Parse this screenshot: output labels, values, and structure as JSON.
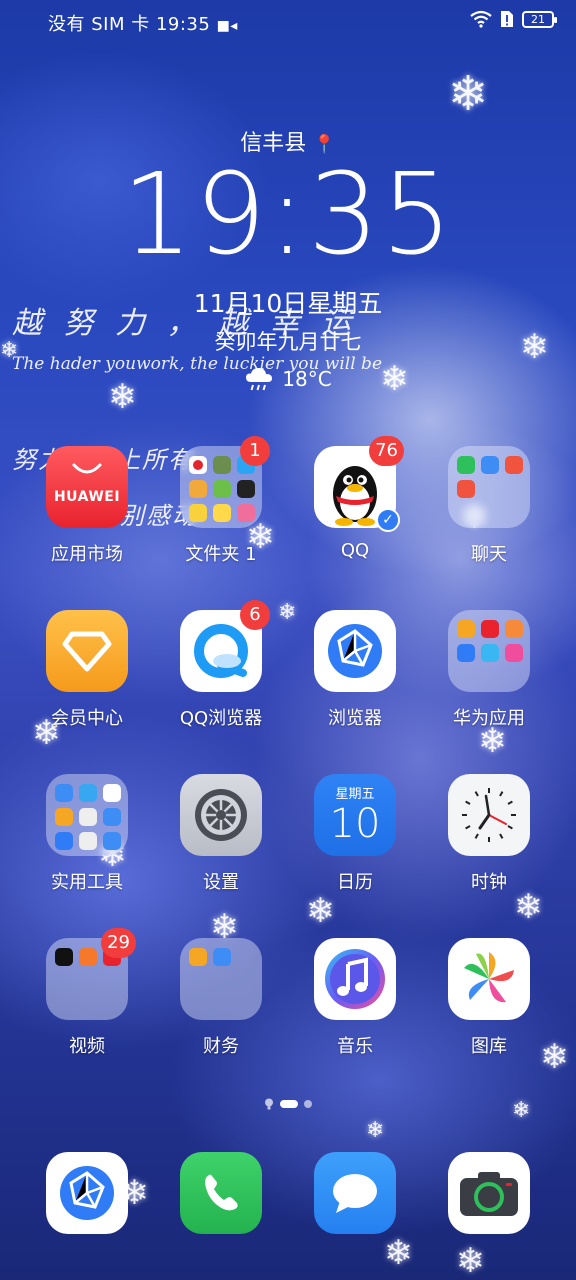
{
  "status_bar": {
    "carrier": "没有 SIM 卡",
    "time": "19:35",
    "battery": "21"
  },
  "widget": {
    "location": "信丰县",
    "time": "19:35",
    "date": "11月10日星期五",
    "lunar": "癸卯年九月廿七",
    "temperature": "18°C"
  },
  "decor": {
    "line1": "越 努 力 ， 越 幸 运",
    "line2": "The hader youwork, the luckier you will be",
    "line3": "努力配得上所有",
    "line4": "别感动"
  },
  "apps": [
    {
      "label": "应用市场",
      "badge": "",
      "tile_text": "HUAWEI"
    },
    {
      "label": "文件夹 1",
      "badge": "1"
    },
    {
      "label": "QQ",
      "badge": "76"
    },
    {
      "label": "聊天",
      "badge": ""
    },
    {
      "label": "会员中心",
      "badge": ""
    },
    {
      "label": "QQ浏览器",
      "badge": "6"
    },
    {
      "label": "浏览器",
      "badge": ""
    },
    {
      "label": "华为应用",
      "badge": ""
    },
    {
      "label": "实用工具",
      "badge": ""
    },
    {
      "label": "设置",
      "badge": ""
    },
    {
      "label": "日历",
      "badge": "",
      "weekday": "星期五",
      "day": "10"
    },
    {
      "label": "时钟",
      "badge": ""
    },
    {
      "label": "视频",
      "badge": "29"
    },
    {
      "label": "财务",
      "badge": ""
    },
    {
      "label": "音乐",
      "badge": ""
    },
    {
      "label": "图库",
      "badge": ""
    }
  ],
  "dock": [
    "browser-icon",
    "phone-icon",
    "messages-icon",
    "camera-icon"
  ]
}
